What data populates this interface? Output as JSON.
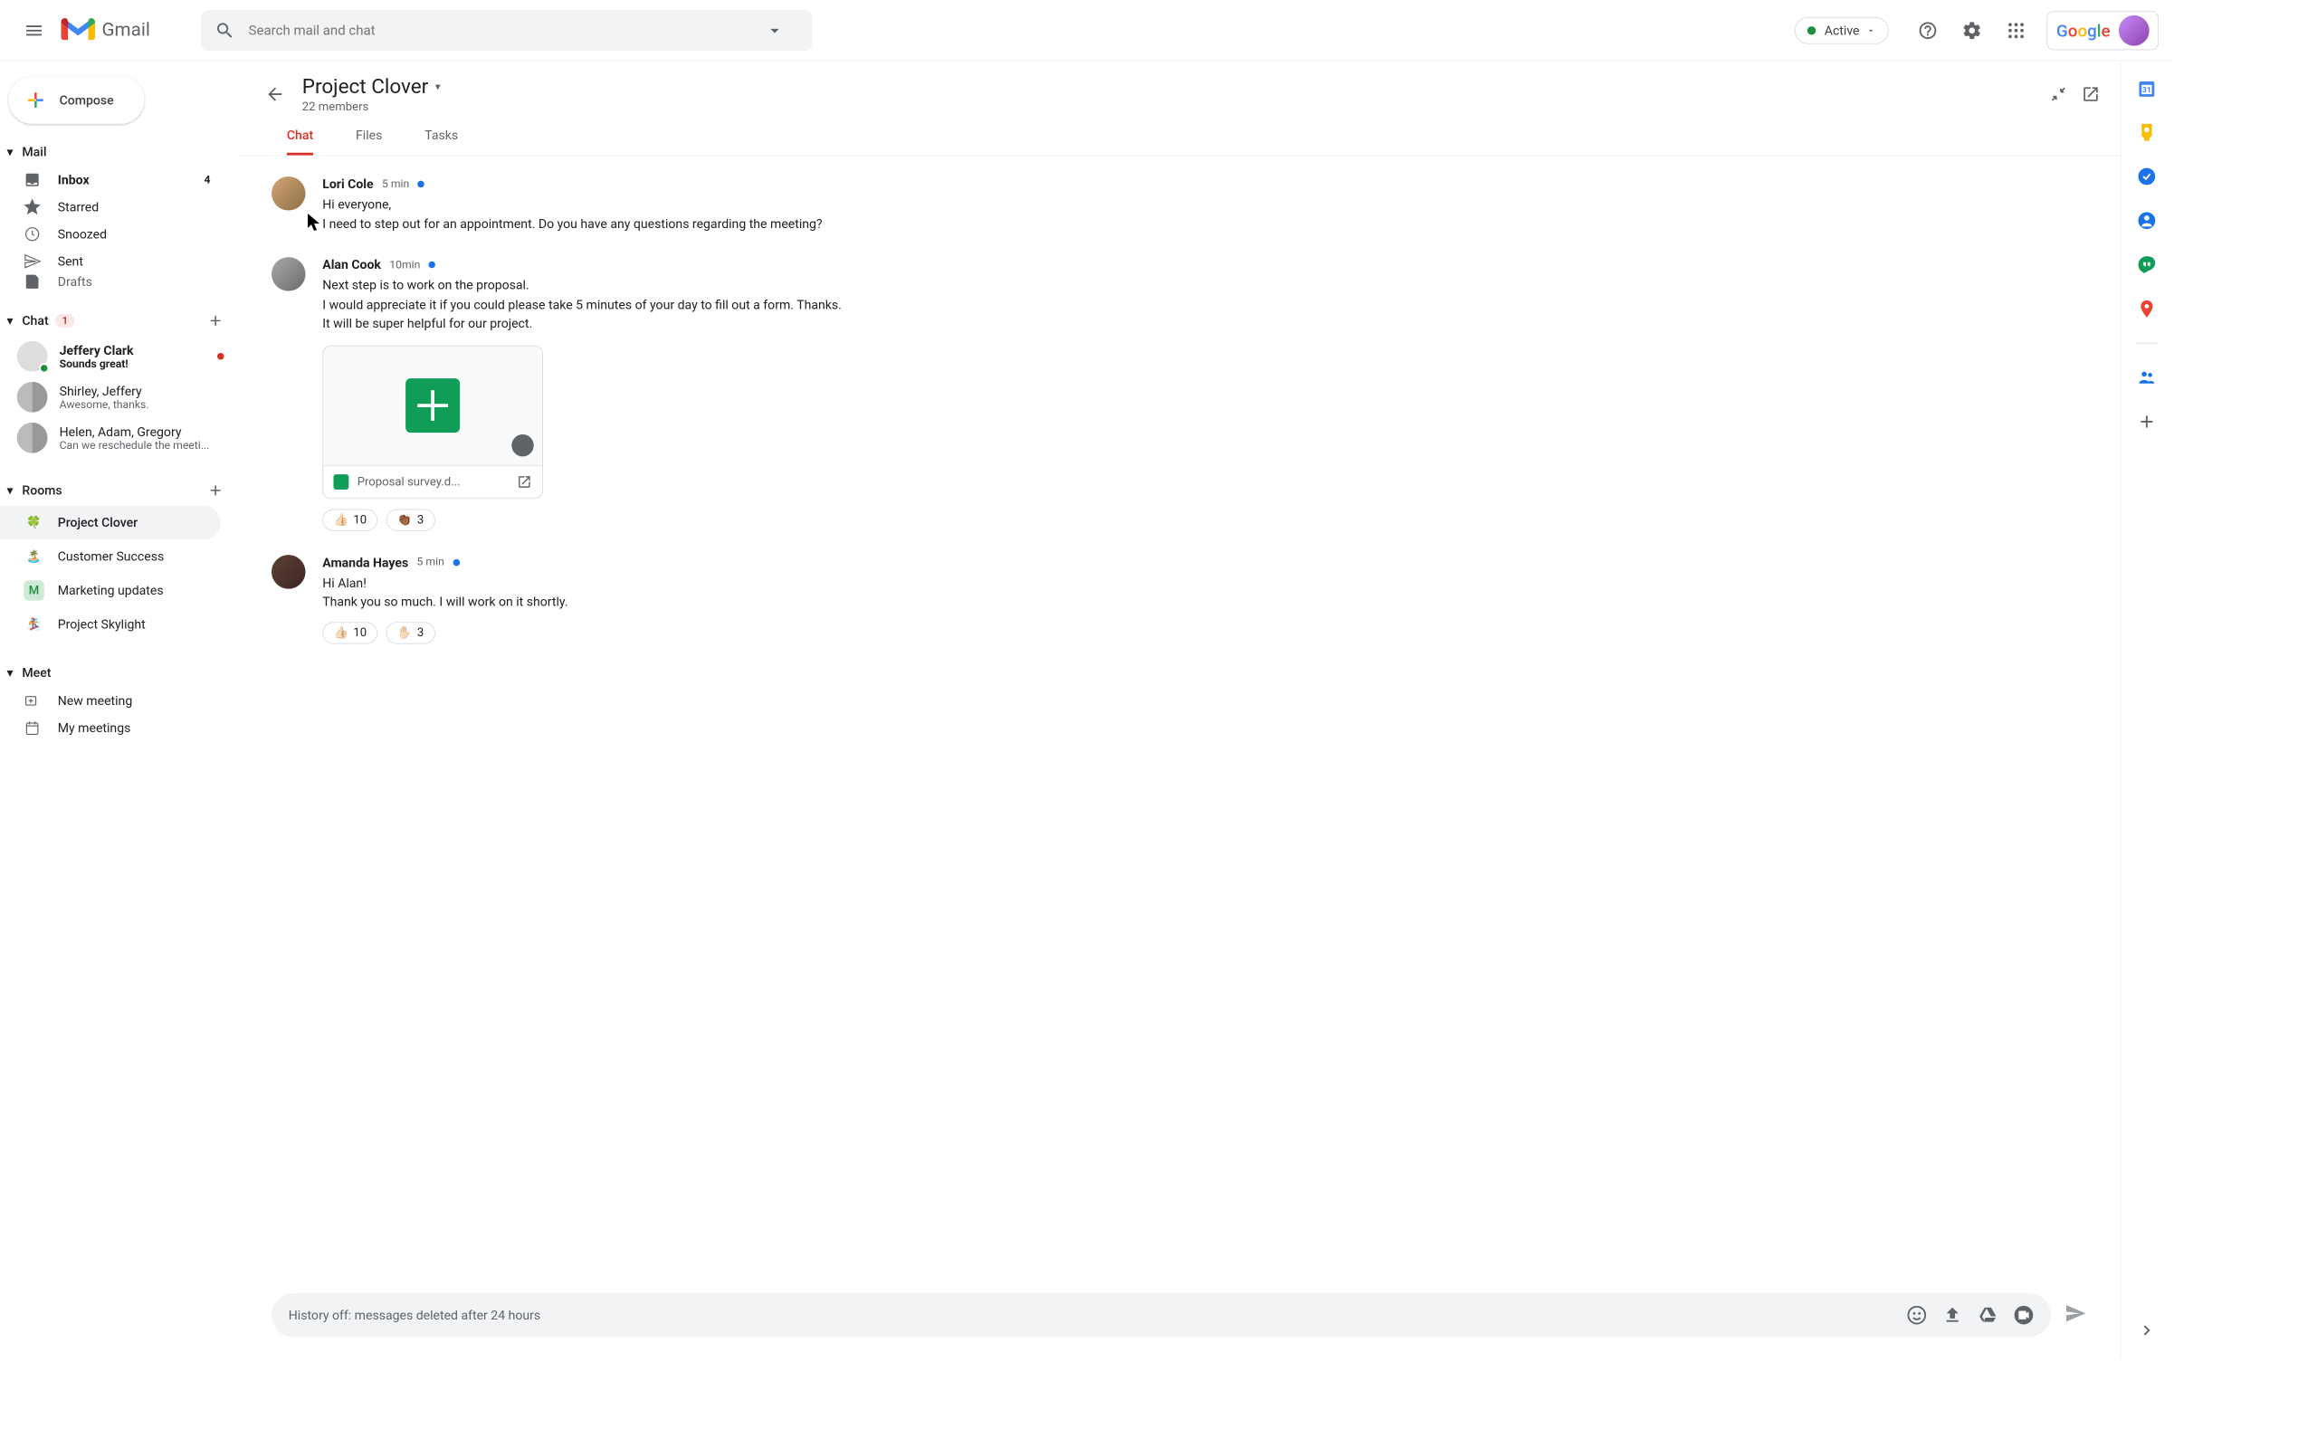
{
  "header": {
    "app_name": "Gmail",
    "search_placeholder": "Search mail and chat",
    "status": "Active"
  },
  "compose_label": "Compose",
  "sections": {
    "mail": {
      "label": "Mail",
      "items": [
        {
          "label": "Inbox",
          "count": "4",
          "bold": true
        },
        {
          "label": "Starred"
        },
        {
          "label": "Snoozed"
        },
        {
          "label": "Sent"
        },
        {
          "label": "Drafts"
        }
      ]
    },
    "chat": {
      "label": "Chat",
      "badge": "1",
      "items": [
        {
          "name": "Jeffery Clark",
          "preview": "Sounds great!",
          "bold": true,
          "unread": true
        },
        {
          "name": "Shirley, Jeffery",
          "preview": "Awesome, thanks."
        },
        {
          "name": "Helen, Adam, Gregory",
          "preview": "Can we reschedule the meeti..."
        }
      ]
    },
    "rooms": {
      "label": "Rooms",
      "items": [
        {
          "label": "Project Clover",
          "emoji": "🍀",
          "active": true
        },
        {
          "label": "Customer Success",
          "emoji": "🏝️"
        },
        {
          "label": "Marketing updates",
          "emoji": "M",
          "bg": "#ceead6",
          "color": "#1e8e3e"
        },
        {
          "label": "Project Skylight",
          "emoji": "🏂"
        }
      ]
    },
    "meet": {
      "label": "Meet",
      "items": [
        {
          "label": "New meeting"
        },
        {
          "label": "My meetings"
        }
      ]
    }
  },
  "room": {
    "title": "Project Clover",
    "members": "22 members",
    "tabs": [
      "Chat",
      "Files",
      "Tasks"
    ],
    "active_tab": 0
  },
  "messages": [
    {
      "author": "Lori Cole",
      "time": "5 min",
      "lines": [
        "Hi everyone,",
        "I need to step out for an appointment. Do you have any questions regarding the meeting?"
      ],
      "avatar_bg": "linear-gradient(135deg,#d4a574,#8b6f47)"
    },
    {
      "author": "Alan Cook",
      "time": "10min",
      "lines": [
        "Next step is to work on the proposal.",
        "I would appreciate it if you could please take 5 minutes of your day to fill out a form. Thanks.",
        "It will be super helpful for our project."
      ],
      "attachment": {
        "name": "Proposal survey.d..."
      },
      "reactions": [
        {
          "emoji": "👍🏻",
          "count": "10"
        },
        {
          "emoji": "👏🏾",
          "count": "3"
        }
      ],
      "avatar_bg": "linear-gradient(135deg,#a8a8a8,#6b6b6b)"
    },
    {
      "author": "Amanda Hayes",
      "time": "5 min",
      "lines": [
        "Hi Alan!",
        "Thank you so much. I will work on it shortly."
      ],
      "reactions": [
        {
          "emoji": "👍🏻",
          "count": "10"
        },
        {
          "emoji": "✋🏻",
          "count": "3"
        }
      ],
      "avatar_bg": "linear-gradient(135deg,#5d4037,#3e2723)"
    }
  ],
  "composer_placeholder": "History off: messages deleted after 24 hours"
}
